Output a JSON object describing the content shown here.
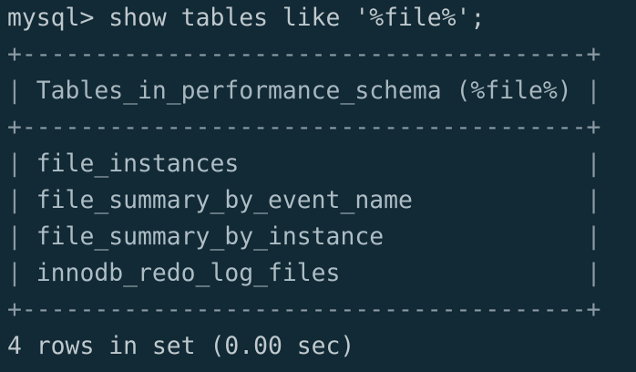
{
  "terminal": {
    "prompt": "mysql>",
    "command": " show tables like '%file%';",
    "border": "+---------------------------------------+",
    "header": {
      "left_pipe": "| ",
      "label": "Tables_in_performance_schema (%file%)",
      "right_pipe": " |"
    },
    "rows": [
      {
        "left_pipe": "| ",
        "value": "file_instances",
        "padding": "                        ",
        "right_pipe": "|"
      },
      {
        "left_pipe": "| ",
        "value": "file_summary_by_event_name",
        "padding": "            ",
        "right_pipe": "|"
      },
      {
        "left_pipe": "| ",
        "value": "file_summary_by_instance",
        "padding": "              ",
        "right_pipe": "|"
      },
      {
        "left_pipe": "| ",
        "value": "innodb_redo_log_files",
        "padding": "                 ",
        "right_pipe": "|"
      }
    ],
    "result_summary": "4 rows in set (0.00 sec)"
  },
  "colors": {
    "background": "#112a35",
    "text": "#bfc8cd",
    "border": "#8a9aa3"
  }
}
